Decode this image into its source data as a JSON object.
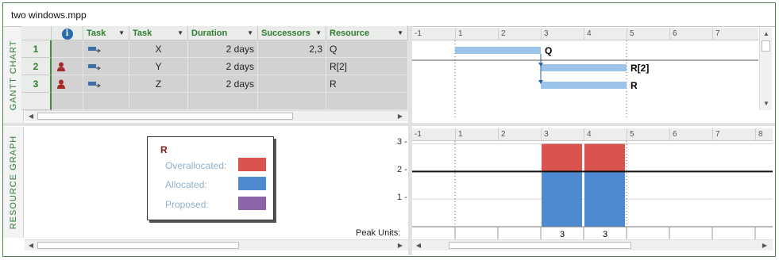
{
  "window": {
    "title": "two windows.mpp"
  },
  "gantt": {
    "pane_label": "GANTT CHART",
    "columns": [
      {
        "label": "",
        "icon": "info-icon"
      },
      {
        "label": "Task"
      },
      {
        "label": "Task"
      },
      {
        "label": "Duration"
      },
      {
        "label": "Successors"
      },
      {
        "label": "Resource"
      }
    ],
    "rows": [
      {
        "id": "1",
        "has_resource_icon": false,
        "name": "X",
        "duration": "2 days",
        "successors": "2,3",
        "resource": "Q"
      },
      {
        "id": "2",
        "has_resource_icon": true,
        "name": "Y",
        "duration": "2 days",
        "successors": "",
        "resource": "R[2]"
      },
      {
        "id": "3",
        "has_resource_icon": true,
        "name": "Z",
        "duration": "2 days",
        "successors": "",
        "resource": "R"
      }
    ],
    "timescale": [
      "-1",
      "1",
      "2",
      "3",
      "4",
      "5",
      "6",
      "7"
    ],
    "bars": [
      {
        "label": "Q",
        "start": 1,
        "end": 3
      },
      {
        "label": "R[2]",
        "start": 3,
        "end": 5
      },
      {
        "label": "R",
        "start": 3,
        "end": 5
      }
    ],
    "bar_color": "#9cc3e9"
  },
  "resource_graph": {
    "pane_label": "RESOURCE GRAPH",
    "resource_name": "R",
    "legend": [
      {
        "label": "Overallocated:",
        "color": "#d9534f"
      },
      {
        "label": "Allocated:",
        "color": "#4d8ad0"
      },
      {
        "label": "Proposed:",
        "color": "#8a65a8"
      }
    ],
    "timescale": [
      "-1",
      "1",
      "2",
      "3",
      "4",
      "5",
      "6",
      "7",
      "8"
    ],
    "y_ticks": [
      "3",
      "2",
      "1"
    ],
    "max_units": 2,
    "peak_label": "Peak Units:",
    "peak_values": [
      "3",
      "3"
    ],
    "chart_data": {
      "type": "bar",
      "categories": [
        "3",
        "4"
      ],
      "series": [
        {
          "name": "Allocated:",
          "values": [
            2,
            2
          ]
        },
        {
          "name": "Overallocated:",
          "values": [
            1,
            1
          ]
        }
      ],
      "ylim": [
        0,
        3
      ]
    }
  }
}
